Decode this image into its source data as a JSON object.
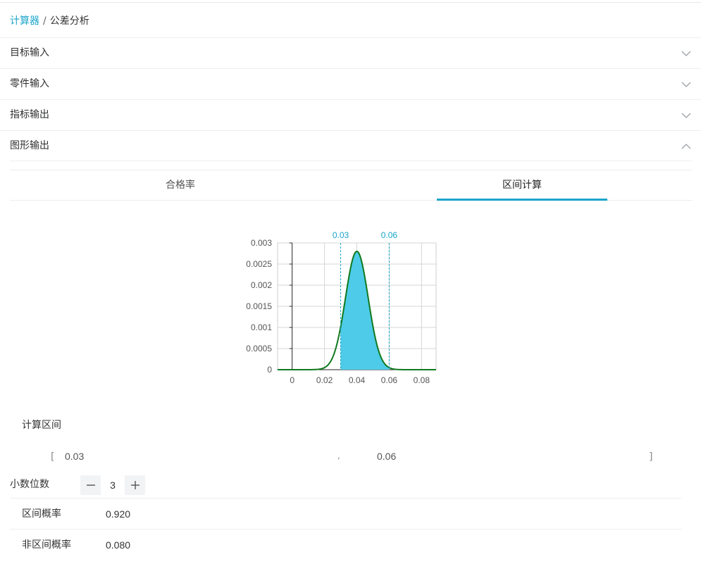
{
  "breadcrumb": {
    "root": "计算器",
    "separator": "/",
    "current": "公差分析"
  },
  "sections": [
    {
      "label": "目标输入",
      "expanded": false
    },
    {
      "label": "零件输入",
      "expanded": false
    },
    {
      "label": "指标输出",
      "expanded": false
    },
    {
      "label": "图形输出",
      "expanded": true
    }
  ],
  "tabs": [
    {
      "label": "合格率",
      "active": false
    },
    {
      "label": "区间计算",
      "active": true
    }
  ],
  "colors": {
    "accent": "#1aa5c9",
    "curve": "#0f7a1f",
    "fill": "#4ecbe8",
    "marker": "#1aa5c9"
  },
  "chart_data": {
    "type": "area",
    "distribution": "normal",
    "mean": 0.04,
    "std": 0.00703,
    "peak": 0.0028,
    "xlim": [
      -0.009,
      0.089
    ],
    "ylim": [
      0,
      0.003
    ],
    "x_ticks": [
      "0",
      "0.02",
      "0.04",
      "0.06",
      "0.08"
    ],
    "x_tick_values": [
      0,
      0.02,
      0.04,
      0.06,
      0.08
    ],
    "y_ticks": [
      "0",
      "0.0005",
      "0.001",
      "0.0015",
      "0.002",
      "0.0025",
      "0.003"
    ],
    "y_tick_values": [
      0,
      0.0005,
      0.001,
      0.0015,
      0.002,
      0.0025,
      0.003
    ],
    "shaded_range": [
      0.03,
      0.06
    ],
    "markers": [
      {
        "x": 0.03,
        "label": "0.03"
      },
      {
        "x": 0.06,
        "label": "0.06"
      }
    ],
    "grid": true
  },
  "interval": {
    "title": "计算区间",
    "open_bracket": "[",
    "lower": "0.03",
    "comma": ",",
    "upper": "0.06",
    "close_bracket": "]"
  },
  "decimals": {
    "label": "小数位数",
    "value": "3"
  },
  "results": [
    {
      "label": "区间概率",
      "value": "0.920"
    },
    {
      "label": "非区间概率",
      "value": "0.080"
    }
  ]
}
